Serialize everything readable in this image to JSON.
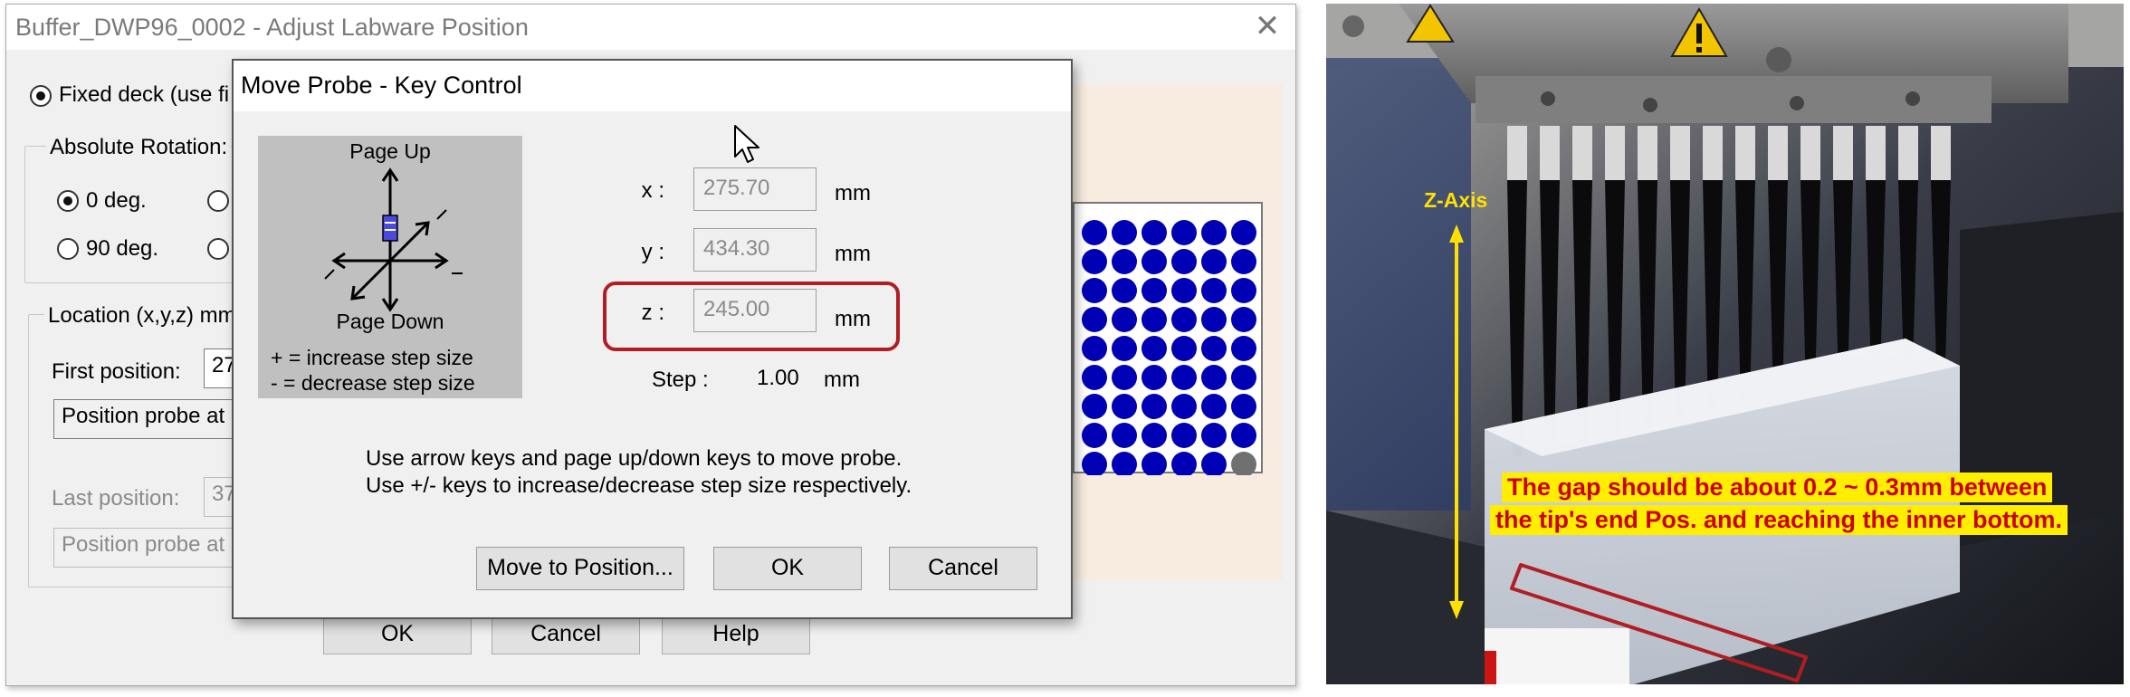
{
  "parent_dialog": {
    "title": "Buffer_DWP96_0002 - Adjust Labware Position",
    "fixed_deck_label": "Fixed deck (use fi",
    "rotation_group_label": "Absolute Rotation:",
    "rotation_0": "0 deg.",
    "rotation_90": "90 deg.",
    "location_group_label": "Location (x,y,z) mm",
    "first_position_label": "First position:",
    "first_position_value": "27",
    "position_probe_label_1": "Position probe at",
    "last_position_label": "Last position:",
    "last_position_value": "37",
    "position_probe_label_2": "Position probe at",
    "ok_label": "OK",
    "cancel_label": "Cancel",
    "help_label": "Help",
    "close_glyph": "✕"
  },
  "probe_dialog": {
    "title": "Move Probe - Key Control",
    "keypad": {
      "page_up": "Page Up",
      "page_down": "Page Down",
      "increase": "+ = increase step size",
      "decrease": "- = decrease step size"
    },
    "x_label": "x :",
    "x_value": "275.70",
    "y_label": "y :",
    "y_value": "434.30",
    "z_label": "z :",
    "z_value": "245.00",
    "unit": "mm",
    "step_label": "Step :",
    "step_value": "1.00",
    "step_unit": "mm",
    "instruction_1": "Use arrow keys and page up/down keys to move probe.",
    "instruction_2": "Use +/- keys to increase/decrease step size respectively.",
    "move_button": "Move to Position...",
    "ok_button": "OK",
    "cancel_button": "Cancel"
  },
  "photo": {
    "axis_label": "Z-Axis",
    "annotation_line_1": "The gap should be about 0.2 ~ 0.3mm between",
    "annotation_line_2": "the tip's end Pos. and reaching the inner bottom."
  },
  "colors": {
    "highlight_box": "#b01e23",
    "well_blue": "#0000b4",
    "well_gray": "#707070",
    "annotation_bg": "#ffee00",
    "annotation_text": "#cc0000",
    "axis_yellow": "#ffe000"
  }
}
